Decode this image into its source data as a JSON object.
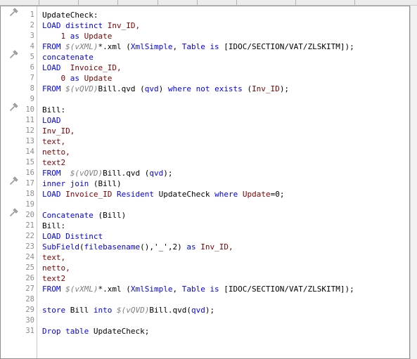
{
  "editor": {
    "line_numbers": [
      "1",
      "2",
      "3",
      "4",
      "5",
      "6",
      "7",
      "8",
      "9",
      "10",
      "11",
      "12",
      "13",
      "14",
      "15",
      "16",
      "17",
      "18",
      "19",
      "20",
      "21",
      "22",
      "23",
      "24",
      "25",
      "26",
      "27",
      "28",
      "29",
      "30",
      "31"
    ],
    "lines": [
      [
        {
          "t": "UpdateCheck:",
          "c": ""
        }
      ],
      [
        {
          "t": "LOAD distinct ",
          "c": "kw"
        },
        {
          "t": "Inv_ID,",
          "c": "fld"
        }
      ],
      [
        {
          "t": "    1 ",
          "c": "fld"
        },
        {
          "t": "as ",
          "c": "kw"
        },
        {
          "t": "Update",
          "c": "fld"
        }
      ],
      [
        {
          "t": "FROM ",
          "c": "kw"
        },
        {
          "t": "$(vXML)",
          "c": "var"
        },
        {
          "t": "*.xml (",
          "c": ""
        },
        {
          "t": "XmlSimple",
          "c": "kw"
        },
        {
          "t": ", ",
          "c": ""
        },
        {
          "t": "Table is",
          "c": "kw"
        },
        {
          "t": " [IDOC/SECTION/VAT/ZLSKITM]);",
          "c": ""
        }
      ],
      [
        {
          "t": "concatenate",
          "c": "kw"
        }
      ],
      [
        {
          "t": "LOAD  ",
          "c": "kw"
        },
        {
          "t": "Invoice_ID,",
          "c": "fld"
        }
      ],
      [
        {
          "t": "    0 ",
          "c": "fld"
        },
        {
          "t": "as ",
          "c": "kw"
        },
        {
          "t": "Update",
          "c": "fld"
        }
      ],
      [
        {
          "t": "FROM ",
          "c": "kw"
        },
        {
          "t": "$(vQVD)",
          "c": "var"
        },
        {
          "t": "Bill.qvd (",
          "c": ""
        },
        {
          "t": "qvd",
          "c": "kw"
        },
        {
          "t": ") ",
          "c": ""
        },
        {
          "t": "where not exists ",
          "c": "kw"
        },
        {
          "t": "(",
          "c": ""
        },
        {
          "t": "Inv_ID",
          "c": "fld"
        },
        {
          "t": ");",
          "c": ""
        }
      ],
      [],
      [
        {
          "t": "Bill:",
          "c": ""
        }
      ],
      [
        {
          "t": "LOAD",
          "c": "kw"
        }
      ],
      [
        {
          "t": "Inv_ID,",
          "c": "fld"
        }
      ],
      [
        {
          "t": "text,",
          "c": "fld"
        }
      ],
      [
        {
          "t": "netto,",
          "c": "fld"
        }
      ],
      [
        {
          "t": "text2",
          "c": "fld"
        }
      ],
      [
        {
          "t": "FROM  ",
          "c": "kw"
        },
        {
          "t": "$(vQVD)",
          "c": "var"
        },
        {
          "t": "Bill.qvd (",
          "c": ""
        },
        {
          "t": "qvd",
          "c": "kw"
        },
        {
          "t": ");",
          "c": ""
        }
      ],
      [
        {
          "t": "inner join ",
          "c": "kw"
        },
        {
          "t": "(Bill)",
          "c": ""
        }
      ],
      [
        {
          "t": "LOAD ",
          "c": "kw"
        },
        {
          "t": "Invoice_ID ",
          "c": "fld"
        },
        {
          "t": "Resident ",
          "c": "kw"
        },
        {
          "t": "UpdateCheck ",
          "c": ""
        },
        {
          "t": "where ",
          "c": "kw"
        },
        {
          "t": "Update",
          "c": "fld"
        },
        {
          "t": "=0;",
          "c": ""
        }
      ],
      [],
      [
        {
          "t": "Concatenate ",
          "c": "kw"
        },
        {
          "t": "(Bill)",
          "c": ""
        }
      ],
      [
        {
          "t": "Bill:",
          "c": ""
        }
      ],
      [
        {
          "t": "LOAD Distinct",
          "c": "kw"
        }
      ],
      [
        {
          "t": "SubField",
          "c": "kw"
        },
        {
          "t": "(",
          "c": ""
        },
        {
          "t": "filebasename",
          "c": "kw"
        },
        {
          "t": "(),'_',2) ",
          "c": ""
        },
        {
          "t": "as ",
          "c": "kw"
        },
        {
          "t": "Inv_ID,",
          "c": "fld"
        }
      ],
      [
        {
          "t": "text,",
          "c": "fld"
        }
      ],
      [
        {
          "t": "netto,",
          "c": "fld"
        }
      ],
      [
        {
          "t": "text2",
          "c": "fld"
        }
      ],
      [
        {
          "t": "FROM ",
          "c": "kw"
        },
        {
          "t": "$(vXML)",
          "c": "var"
        },
        {
          "t": "*.xml (",
          "c": ""
        },
        {
          "t": "XmlSimple",
          "c": "kw"
        },
        {
          "t": ", ",
          "c": ""
        },
        {
          "t": "Table is",
          "c": "kw"
        },
        {
          "t": " [IDOC/SECTION/VAT/ZLSKITM]);",
          "c": ""
        }
      ],
      [],
      [
        {
          "t": "store ",
          "c": "kw"
        },
        {
          "t": "Bill ",
          "c": ""
        },
        {
          "t": "into ",
          "c": "kw"
        },
        {
          "t": "$(vQVD)",
          "c": "var"
        },
        {
          "t": "Bill.qvd(",
          "c": ""
        },
        {
          "t": "qvd",
          "c": "kw"
        },
        {
          "t": ");",
          "c": ""
        }
      ],
      [],
      [
        {
          "t": "Drop table ",
          "c": "kw"
        },
        {
          "t": "UpdateCheck;",
          "c": ""
        }
      ]
    ],
    "section_markers": [
      "1",
      "5",
      "10",
      "17",
      "20"
    ]
  },
  "colors": {
    "keyword": "#0000ff",
    "field": "#800000",
    "variable": "#808080",
    "line_number": "#8c8c8c"
  }
}
